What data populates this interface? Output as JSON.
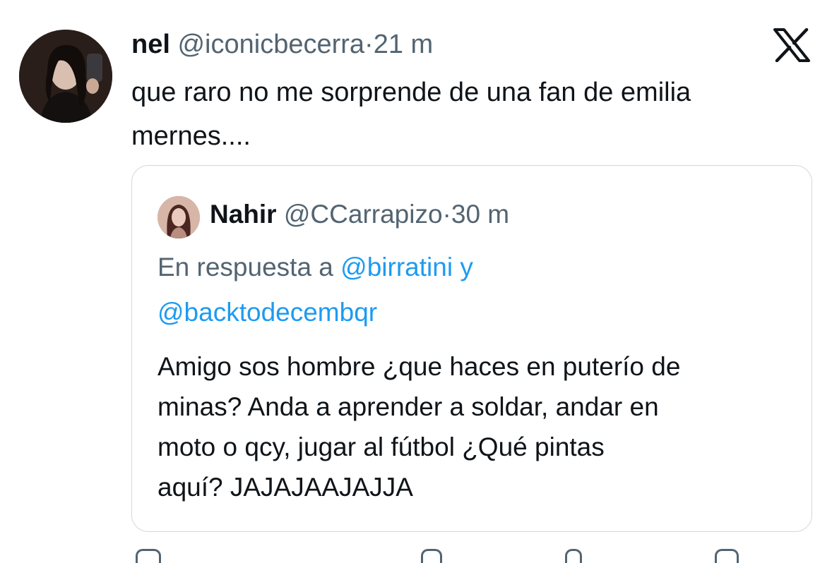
{
  "tweet": {
    "author_name": "nel",
    "author_handle": "@iconicbecerra",
    "separator": "·",
    "time": "21 m",
    "text_line1": "que raro no me sorprende de una fan de emilia",
    "text_line2": "mernes...."
  },
  "quoted_tweet": {
    "author_name": "Nahir",
    "author_handle": "@CCarrapizo",
    "separator": "·",
    "time": "30 m",
    "reply_prefix": "En respuesta a",
    "reply_mention1": "@birratini",
    "reply_conj": "y",
    "reply_mention2": "@backtodecembqr",
    "lines": [
      "Amigo sos hombre ¿que haces en puterío de",
      "minas? Anda a aprender a soldar, andar en",
      "moto o qcy, jugar al fútbol ¿Qué pintas",
      "aquí?  JAJAJAAJAJJA"
    ]
  },
  "icons": {
    "brand": "x-logo-icon"
  },
  "colors": {
    "text": "#0f1419",
    "secondary": "#536471",
    "link": "#1d9bf0",
    "border": "#cfd9de"
  }
}
